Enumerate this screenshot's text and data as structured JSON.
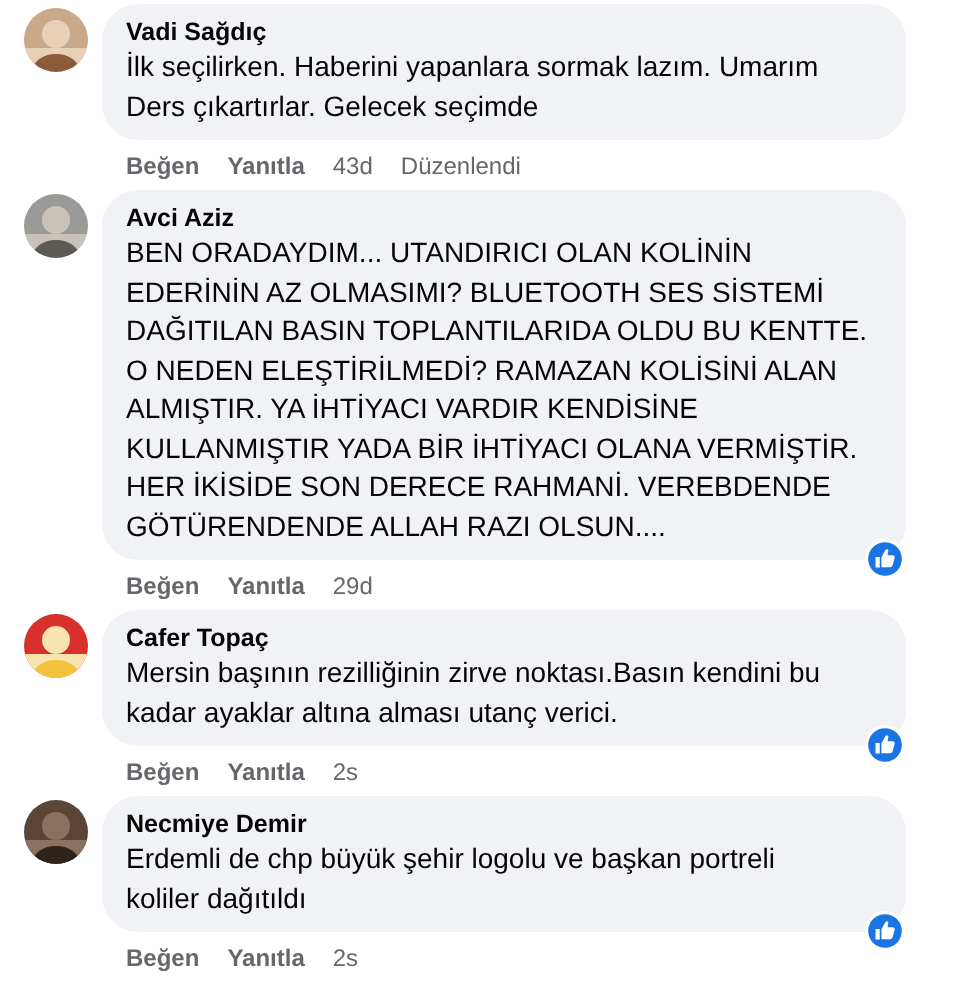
{
  "comments": [
    {
      "author": "Vadi Sağdıç",
      "lines": [
        "İlk seçilirken. Haberini yapanlara sormak lazım. Umarım",
        "Ders çıkartırlar. Gelecek seçimde"
      ],
      "like": "Beğen",
      "reply": "Yanıtla",
      "time": "43d",
      "edited": "Düzenlendi",
      "reaction_badge": false
    },
    {
      "author": "Avci Aziz",
      "lines": [
        "BEN ORADAYDIM... UTANDIRICI OLAN KOLİNİN",
        "EDERİNİN AZ OLMASIMI? BLUETOOTH SES SİSTEMİ",
        "DAĞITILAN BASIN TOPLANTILARIDA OLDU BU KENTTE.",
        "O NEDEN ELEŞTİRİLMEDİ? RAMAZAN KOLİSİNİ ALAN",
        "ALMIŞTIR. YA İHTİYACI VARDIR KENDİSİNE",
        "KULLANMIŞTIR YADA BİR İHTİYACI OLANA VERMİŞTİR.",
        "HER İKİSİDE SON DERECE RAHMANİ. VEREBDENDE",
        "GÖTÜRENDENDE ALLAH RAZI OLSUN...."
      ],
      "like": "Beğen",
      "reply": "Yanıtla",
      "time": "29d",
      "reaction_badge": true
    },
    {
      "author": "Cafer Topaç",
      "lines": [
        "Mersin başının rezilliğinin zirve noktası.Basın kendini bu",
        "kadar ayaklar altına alması utanç verici."
      ],
      "like": "Beğen",
      "reply": "Yanıtla",
      "time": "2s",
      "reaction_badge": true
    },
    {
      "author": "Necmiye Demir",
      "lines": [
        "Erdemli de chp büyük şehir logolu ve başkan portreli",
        "koliler dağıtıldı"
      ],
      "like": "Beğen",
      "reply": "Yanıtla",
      "time": "2s",
      "reaction_badge": true
    }
  ]
}
